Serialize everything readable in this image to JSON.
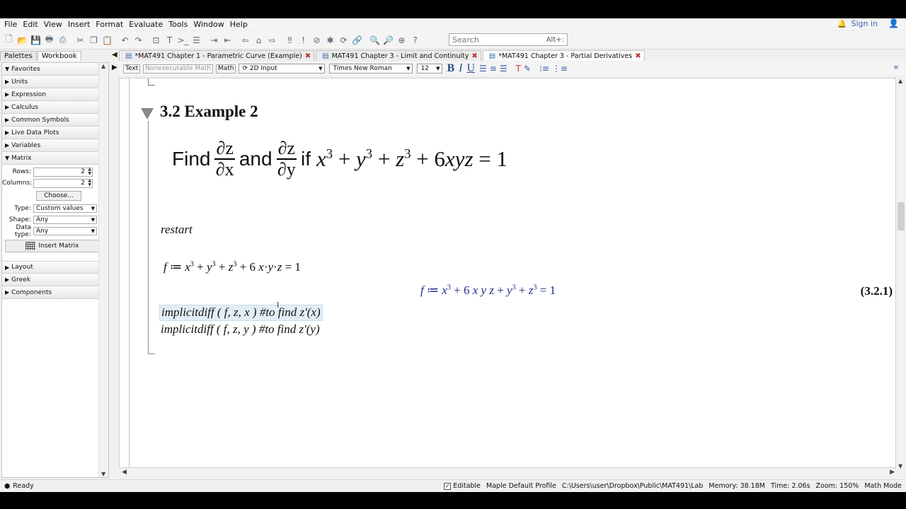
{
  "menu": [
    "File",
    "Edit",
    "View",
    "Insert",
    "Format",
    "Evaluate",
    "Tools",
    "Window",
    "Help"
  ],
  "account": {
    "signin_label": "Sign in"
  },
  "search": {
    "placeholder": "Search",
    "shortcut": "Alt+:"
  },
  "left_panel": {
    "tabs": [
      "Palettes",
      "Workbook"
    ],
    "palettes_top": [
      "Favorites",
      "Units",
      "Expression",
      "Calculus",
      "Common Symbols",
      "Live Data Plots",
      "Variables",
      "Matrix"
    ],
    "matrix": {
      "rows_label": "Rows:",
      "rows_value": "2",
      "columns_label": "Columns:",
      "columns_value": "2",
      "choose_label": "Choose...",
      "type_label": "Type:",
      "type_value": "Custom values",
      "shape_label": "Shape:",
      "shape_value": "Any",
      "datatype_label": "Data type:",
      "datatype_value": "Any",
      "insert_label": "Insert Matrix"
    },
    "palettes_bottom": [
      "Layout",
      "Greek",
      "Components"
    ]
  },
  "doc_tabs": [
    {
      "label": "*MAT491 Chapter 1 - Parametric Curve (Example)",
      "active": false
    },
    {
      "label": "MAT491 Chapter 3 - Limit and Continuity",
      "active": false
    },
    {
      "label": "*MAT491 Chapter 3 - Partial Derivatives",
      "active": true
    }
  ],
  "format_bar": {
    "text_btn": "Text",
    "nonexec_btn": "Nonexecutable Math",
    "math_btn": "Math",
    "input_mode": "2D Input",
    "font": "Times New Roman",
    "size": "12"
  },
  "document": {
    "section_title": "3.2 Example 2",
    "find_word": "Find",
    "and_word": "and",
    "if_word": "if",
    "frac1_num": "∂z",
    "frac1_den": "∂x",
    "frac2_num": "∂z",
    "frac2_den": "∂y",
    "restart": "restart",
    "eq_label": "(3.2.1)",
    "cmd1": "implicitdiff ( f, z, x )  #to find z'(x)",
    "cmd2": "implicitdiff ( f, z, y )   #to find z'(y)"
  },
  "status": {
    "ready": "Ready",
    "editable": "Editable",
    "profile": "Maple Default Profile",
    "path": "C:\\Users\\user\\Dropbox\\Public\\MAT491\\Lab",
    "memory": "Memory: 38.18M",
    "time": "Time: 2.06s",
    "zoom": "Zoom: 150%",
    "mode": "Math Mode"
  },
  "colors": {
    "output_blue": "#1e2c8c",
    "accent": "#3a5fa8",
    "selection": "#e2eef7"
  }
}
